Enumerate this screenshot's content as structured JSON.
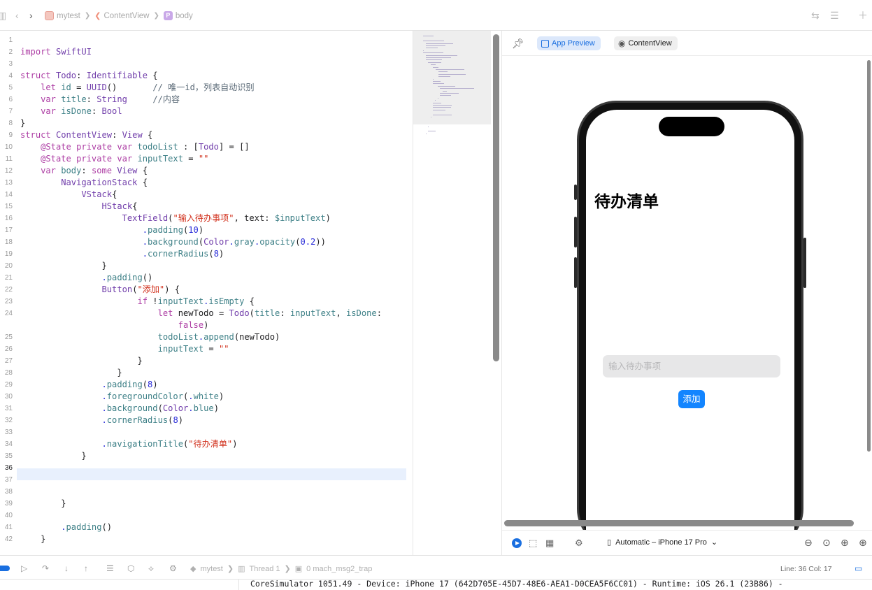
{
  "breadcrumb": {
    "project": "mytest",
    "file": "ContentView",
    "symbol_badge": "P",
    "symbol": "body"
  },
  "editor": {
    "current_line": 36,
    "lines": [
      {
        "n": "1",
        "text": ""
      },
      {
        "n": "2",
        "text": "import SwiftUI"
      },
      {
        "n": "3",
        "text": ""
      },
      {
        "n": "4",
        "text": "struct Todo: Identifiable {"
      },
      {
        "n": "5",
        "text": "    let id = UUID()       // 唯一id，列表自动识别"
      },
      {
        "n": "6",
        "text": "    var title: String     //内容"
      },
      {
        "n": "7",
        "text": "    var isDone: Bool"
      },
      {
        "n": "8",
        "text": "}"
      },
      {
        "n": "9",
        "text": "struct ContentView: View {"
      },
      {
        "n": "10",
        "text": "    @State private var todoList : [Todo] = []"
      },
      {
        "n": "11",
        "text": "    @State private var inputText = \"\""
      },
      {
        "n": "12",
        "text": "    var body: some View {"
      },
      {
        "n": "13",
        "text": "        NavigationStack {"
      },
      {
        "n": "14",
        "text": "            VStack{"
      },
      {
        "n": "15",
        "text": "                HStack{"
      },
      {
        "n": "16",
        "text": "                    TextField(\"输入待办事项\", text: $inputText)"
      },
      {
        "n": "17",
        "text": "                        .padding(10)"
      },
      {
        "n": "18",
        "text": "                        .background(Color.gray.opacity(0.2))"
      },
      {
        "n": "19",
        "text": "                        .cornerRadius(8)"
      },
      {
        "n": "20",
        "text": "                }"
      },
      {
        "n": "21",
        "text": "                .padding()"
      },
      {
        "n": "22",
        "text": "                Button(\"添加\") {"
      },
      {
        "n": "23",
        "text": "                       if !inputText.isEmpty {"
      },
      {
        "n": "24",
        "text": "                           let newTodo = Todo(title: inputText, isDone:"
      },
      {
        "n": "",
        "text": "                               false)"
      },
      {
        "n": "25",
        "text": "                           todoList.append(newTodo)"
      },
      {
        "n": "26",
        "text": "                           inputText = \"\""
      },
      {
        "n": "27",
        "text": "                       }"
      },
      {
        "n": "28",
        "text": "                   }"
      },
      {
        "n": "29",
        "text": "                .padding(8)"
      },
      {
        "n": "30",
        "text": "                .foregroundColor(.white)"
      },
      {
        "n": "31",
        "text": "                .background(Color.blue)"
      },
      {
        "n": "32",
        "text": "                .cornerRadius(8)"
      },
      {
        "n": "33",
        "text": ""
      },
      {
        "n": "34",
        "text": "                .navigationTitle(\"待办清单\")"
      },
      {
        "n": "35",
        "text": "            }"
      },
      {
        "n": "36",
        "text": ""
      },
      {
        "n": "37",
        "text": ""
      },
      {
        "n": "38",
        "text": ""
      },
      {
        "n": "39",
        "text": "        }"
      },
      {
        "n": "40",
        "text": ""
      },
      {
        "n": "41",
        "text": "        .padding()"
      },
      {
        "n": "42",
        "text": "    }"
      }
    ]
  },
  "preview": {
    "tab_app_preview": "App Preview",
    "tab_content_view": "ContentView",
    "nav_title": "待办清单",
    "textfield_placeholder": "输入待办事项",
    "add_button": "添加",
    "device": "Automatic – iPhone 17 Pro"
  },
  "debug": {
    "target": "mytest",
    "thread": "Thread 1",
    "frame": "0 mach_msg2_trap",
    "line_col": "Line: 36  Col: 17"
  },
  "console": {
    "text": "CoreSimulator 1051.49 - Device: iPhone 17 (642D705E-45D7-48E6-AEA1-D0CEA5F6CC01) - Runtime: iOS 26.1 (23B86) -"
  },
  "colors": {
    "accent": "#1a6fe0",
    "keyword": "#ad3da4",
    "type": "#703daa",
    "string": "#d12f1b",
    "comment": "#5d6c79",
    "method": "#3e8087",
    "number": "#272ad8"
  }
}
